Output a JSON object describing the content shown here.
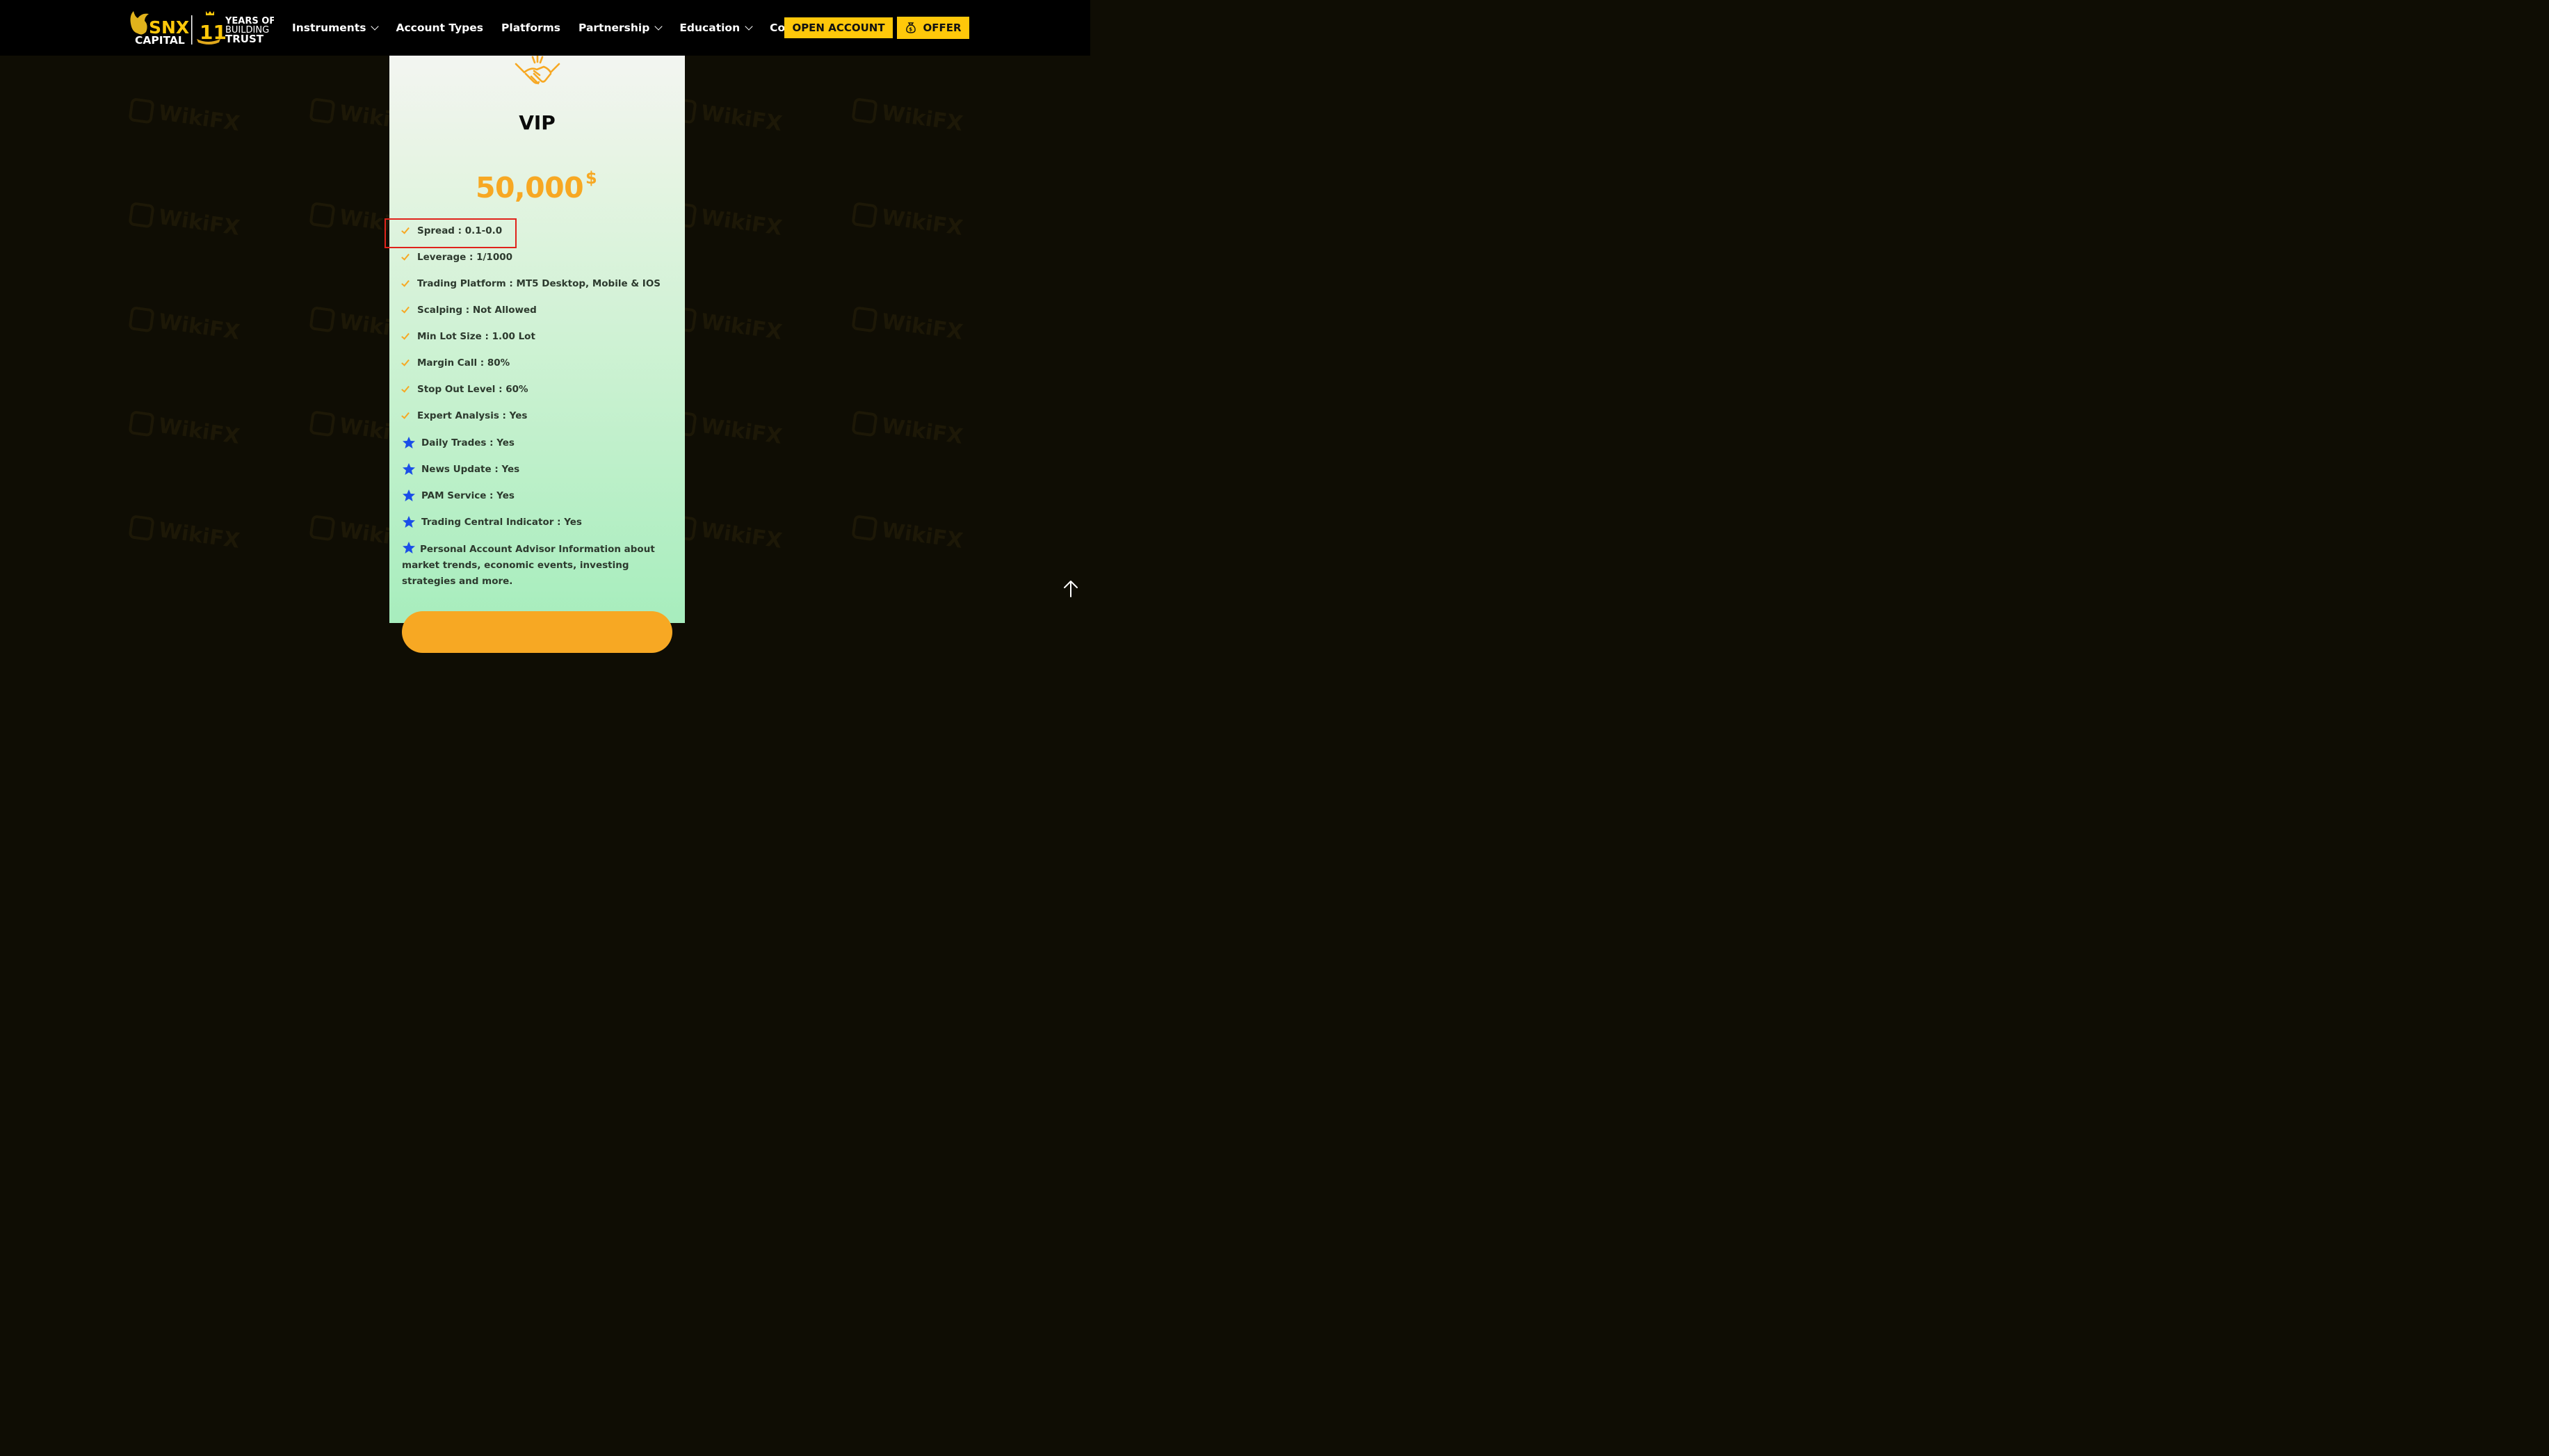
{
  "brand": {
    "name_top": "SNX",
    "name_bottom": "CAPITAL",
    "years_number": "11",
    "years_line1": "YEARS OF",
    "years_line2": "BUILDING",
    "years_line3": "TRUST"
  },
  "nav": [
    {
      "label": "Instruments",
      "dropdown": true
    },
    {
      "label": "Account Types",
      "dropdown": false
    },
    {
      "label": "Platforms",
      "dropdown": false
    },
    {
      "label": "Partnership",
      "dropdown": true
    },
    {
      "label": "Education",
      "dropdown": true
    },
    {
      "label": "Company",
      "dropdown": true
    }
  ],
  "header_buttons": {
    "open_account": "OPEN ACCOUNT",
    "offer": "OFFER"
  },
  "watermark": "WikiFX",
  "plan": {
    "icon": "handshake-icon",
    "title": "VIP",
    "price": "50,000",
    "currency": "$",
    "features": [
      {
        "text": "Spread : 0.1-0.0",
        "icon": "check-icon"
      },
      {
        "text": "Leverage : 1/1000",
        "icon": "check-icon"
      },
      {
        "text": "Trading Platform : MT5 Desktop, Mobile & IOS",
        "icon": "check-icon"
      },
      {
        "text": "Scalping : Not Allowed",
        "icon": "check-icon"
      },
      {
        "text": "Min Lot Size : 1.00 Lot",
        "icon": "check-icon"
      },
      {
        "text": "Margin Call : 80%",
        "icon": "check-icon"
      },
      {
        "text": "Stop Out Level : 60%",
        "icon": "check-icon"
      },
      {
        "text": "Expert Analysis : Yes",
        "icon": "check-icon"
      },
      {
        "text": "Daily Trades : Yes",
        "icon": "star-icon"
      },
      {
        "text": "News Update : Yes",
        "icon": "star-icon"
      },
      {
        "text": "PAM Service : Yes",
        "icon": "star-icon"
      },
      {
        "text": "Trading Central Indicator : Yes",
        "icon": "star-icon"
      }
    ],
    "advisor_text": "Personal Account Advisor Information about market trends, economic events, investing strategies and more."
  },
  "colors": {
    "accent": "#ffc80a",
    "price": "#f7a823",
    "star": "#1a4ee8",
    "highlight": "#e0231b"
  }
}
